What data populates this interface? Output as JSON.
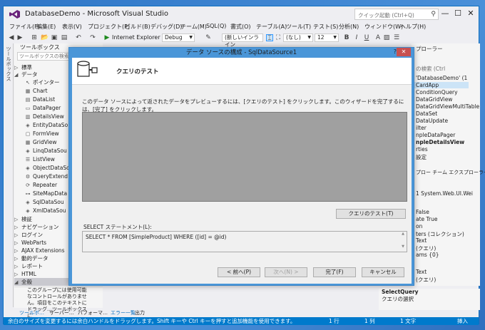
{
  "window": {
    "title": "DatabaseDemo - Microsoft Visual Studio",
    "quick_launch": "クイック起動 (Ctrl+Q)",
    "minimize": "—",
    "restore": "☐",
    "close": "✕"
  },
  "menu": [
    "ファイル(F)",
    "編集(E)",
    "表示(V)",
    "プロジェクト(P)",
    "ビルド(B)",
    "デバッグ(D)",
    "チーム(M)",
    "SQL(Q)",
    "書式(O)",
    "テーブル(A)",
    "ツール(T)",
    "テスト(S)",
    "分析(N)",
    "ウィンドウ(W)",
    "ヘルプ(H)"
  ],
  "toolbar": {
    "browser": "Internet Explorer",
    "config": "Debug",
    "style": "(新しいインライン",
    "font": "(なし)",
    "size": "12",
    "bold": "B",
    "italic": "I",
    "underline": "U",
    "font_color": "A"
  },
  "toolbox": {
    "side_label": "ツールボックス",
    "title": "ツールボックス",
    "search_placeholder": "ツールボックスの検索",
    "sections": [
      {
        "label": "標準",
        "expanded": false
      },
      {
        "label": "データ",
        "expanded": true
      }
    ],
    "items": [
      "ポインター",
      "Chart",
      "DataList",
      "DataPager",
      "DetailsView",
      "EntityDataSo",
      "FormView",
      "GridView",
      "LinqDataSou",
      "ListView",
      "ObjectDataSo",
      "QueryExtend",
      "Repeater",
      "SiteMapData",
      "SqlDataSou",
      "XmlDataSou"
    ],
    "groups": [
      "検証",
      "ナビゲーション",
      "ログイン",
      "WebParts",
      "AJAX Extensions",
      "動的データ",
      "レポート",
      "HTML",
      "全般"
    ],
    "description": "このグループには使用可能なコントロールがありません。項目をこのテキストにドラッグ…ツールボックスに"
  },
  "bottom_tabs": [
    "ツールボ…",
    "サーバー…",
    "パフォーマ…",
    "エラー一覧",
    "出力"
  ],
  "right_panel": {
    "title": "プローラー",
    "search": "の検索 (Ctrl",
    "items": [
      "'DatabaseDemo' (1",
      "CardApp",
      "ConditionQuery",
      "DataGridView",
      "DataGridViewMultiTable",
      "DataSet",
      "DataUpdate",
      "ilter",
      "npleDataPager",
      "npleDetailsView",
      "rties",
      "設定"
    ],
    "tabs": "プロー  チーム エクスプローラー",
    "props_header": "1 System.Web.UI.Wei",
    "props": [
      "False",
      "ate True",
      "on",
      "ters (コレクション)",
      "Text",
      "(クエリ)",
      "ams {0}",
      "Text",
      "(クエリ)"
    ],
    "desc_title": "SelectQuery",
    "desc_text": "クエリの選択"
  },
  "status": {
    "message": "余白のサイズを変更するには余白ハンドルをドラッグします。Shift キーや Ctrl キーを押すと追加機能を使用できます。",
    "line": "1 行",
    "col": "1 列",
    "char": "1 文字",
    "mode": "挿入"
  },
  "dialog": {
    "title": "データ ソースの構成 - SqlDataSource1",
    "help": "?",
    "close": "✕",
    "header_title": "クエリのテスト",
    "instruction": "このデータ ソースによって返されたデータをプレビューするには、[クエリのテスト] をクリックします。このウィザードを完了するには、[完了] をクリックします。",
    "test_button": "クエリのテスト(T)",
    "sql_label": "SELECT ステートメント(L):",
    "sql": "SELECT * FROM [SimpleProduct] WHERE ([id] = @id)",
    "prev_button": "< 前へ(P)",
    "next_button": "次へ(N) >",
    "finish_button": "完了(F)",
    "cancel_button": "キャンセル"
  }
}
